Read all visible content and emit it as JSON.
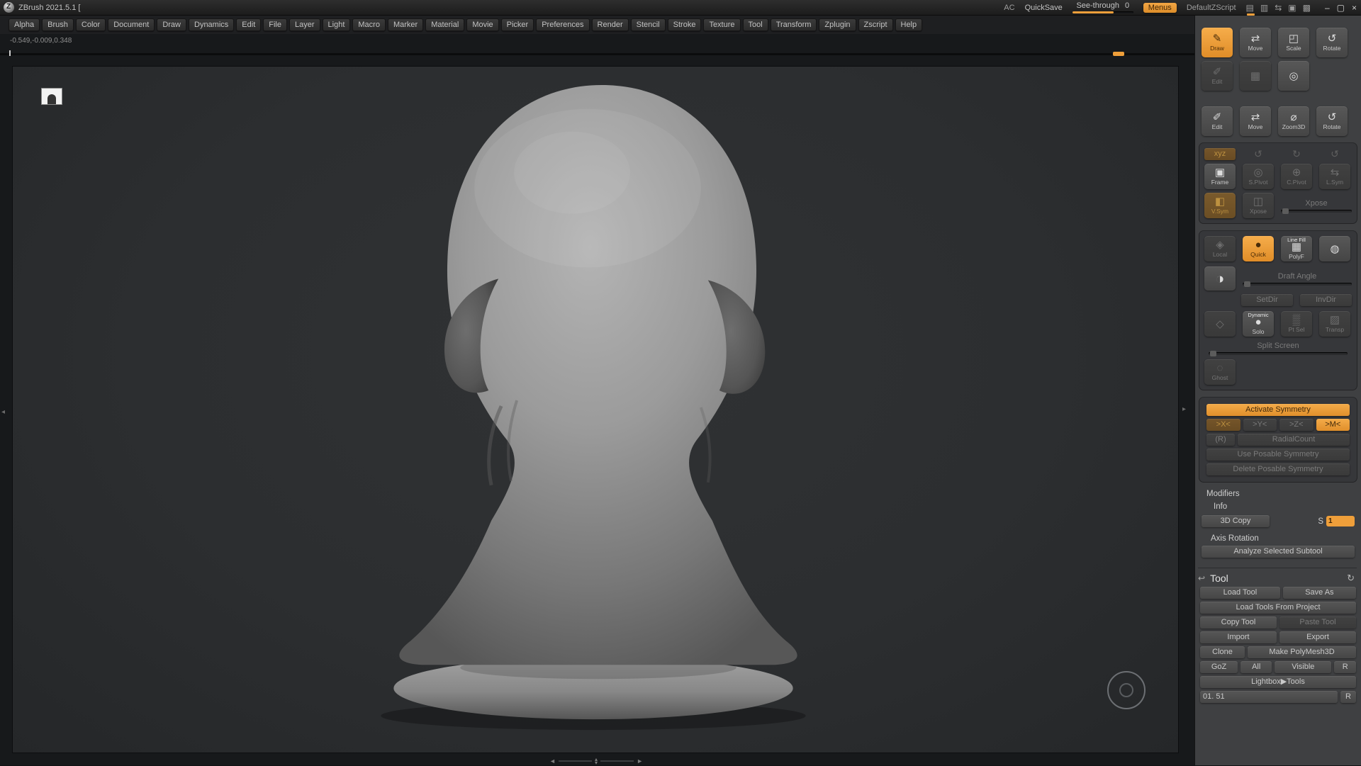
{
  "colors": {
    "accent": "#f0a13e",
    "panel_bg": "#3f4042",
    "canvas_bg": "#2c2e30"
  },
  "title_bar": {
    "app_title": "ZBrush 2021.5.1 [",
    "ac": "AC",
    "quicksave": "QuickSave",
    "see_through_label": "See-through",
    "see_through_value": "0",
    "menus_label": "Menus",
    "zscript_label": "DefaultZScript"
  },
  "menu": {
    "items": [
      "Alpha",
      "Brush",
      "Color",
      "Document",
      "Draw",
      "Dynamics",
      "Edit",
      "File",
      "Layer",
      "Light",
      "Macro",
      "Marker",
      "Material",
      "Movie",
      "Picker",
      "Preferences",
      "Render",
      "Stencil",
      "Stroke",
      "Texture",
      "Tool",
      "Transform",
      "Zplugin",
      "Zscript",
      "Help"
    ]
  },
  "canvas": {
    "coordinates": "-0.549,-0.009,0.348"
  },
  "panel": {
    "edit_mode": {
      "draw": "Draw",
      "move": "Move",
      "scale": "Scale",
      "rotate": "Rotate",
      "edit": "Edit"
    },
    "gyro": {
      "edit": "Edit",
      "move": "Move",
      "zoom3d": "Zoom3D",
      "rotate": "Rotate"
    },
    "pivot": {
      "xyz": "xyz",
      "frame": "Frame",
      "s_pivot": "S.Pivot",
      "c_pivot": "C.Pivot",
      "l_sym": "L.Sym",
      "v_sym": "V.Sym",
      "xpose": "Xpose",
      "xpose_slider": "Xpose"
    },
    "display": {
      "local": "Local",
      "quick": "Quick",
      "line_fill": "Line Fill",
      "polyf": "PolyF",
      "draft_angle": "Draft Angle",
      "setdir": "SetDir",
      "invdir": "InvDir",
      "dynamic": "Dynamic",
      "solo": "Solo",
      "pt_sel": "Pt Sel",
      "transp": "Transp",
      "split_screen": "Split Screen",
      "ghost": "Ghost"
    },
    "symmetry": {
      "activate": "Activate Symmetry",
      "x": ">X<",
      "y": ">Y<",
      "z": ">Z<",
      "m": ">M<",
      "r": "(R)",
      "radial_count": "RadialCount",
      "use_posable": "Use Posable Symmetry",
      "delete_posable": "Delete Posable Symmetry"
    },
    "modifiers": {
      "title": "Modifiers",
      "info": "Info",
      "copy3d": "3D Copy",
      "s_label": "S",
      "s_value": "1",
      "axis_rotation": "Axis Rotation",
      "analyze": "Analyze Selected Subtool"
    },
    "tool": {
      "title": "Tool",
      "load_tool": "Load Tool",
      "save_as": "Save As",
      "load_project": "Load Tools From Project",
      "copy_tool": "Copy Tool",
      "paste_tool": "Paste Tool",
      "import": "Import",
      "export": "Export",
      "clone": "Clone",
      "make_polymesh": "Make PolyMesh3D",
      "goz": "GoZ",
      "all": "All",
      "visible": "Visible",
      "r": "R",
      "lightbox": "Lightbox▶Tools",
      "current_item": "01. 51",
      "current_r": "R"
    }
  },
  "icons": {
    "draw": "✎",
    "move": "⇄",
    "scale": "◰",
    "rotate": "↺",
    "edit": "✐",
    "frame_pic": "▦",
    "camera": "◎",
    "gyro_edit": "✐",
    "gyro_move": "⇄",
    "zoom3d": "⌀",
    "gyro_rotate": "↺",
    "rot_a": "↺",
    "rot_b": "↻",
    "rot_c": "↺",
    "frame": "▣",
    "s_pivot": "◎",
    "c_pivot": "⊕",
    "l_sym": "⇆",
    "v_sym": "◧",
    "xpose": "◫",
    "local": "◈",
    "quick": "●",
    "polyf": "▦",
    "globe": "◍",
    "backface": "◑",
    "cube": "◇",
    "solo": "●",
    "pt_sel": "▒",
    "transp": "▨",
    "ghost": "◌",
    "tool_arrow": "↩",
    "tool_cycle": "↻",
    "t1": "▤",
    "t2": "▥",
    "t3": "⇆",
    "t4": "▣",
    "t5": "▩",
    "win_min": "–",
    "win_max": "▢",
    "win_close": "×",
    "scroll_left": "◄",
    "scroll_right": "►",
    "scroll_up": "▴",
    "scroll_down": "▾",
    "edge_left": "◂",
    "edge_right": "▸"
  }
}
